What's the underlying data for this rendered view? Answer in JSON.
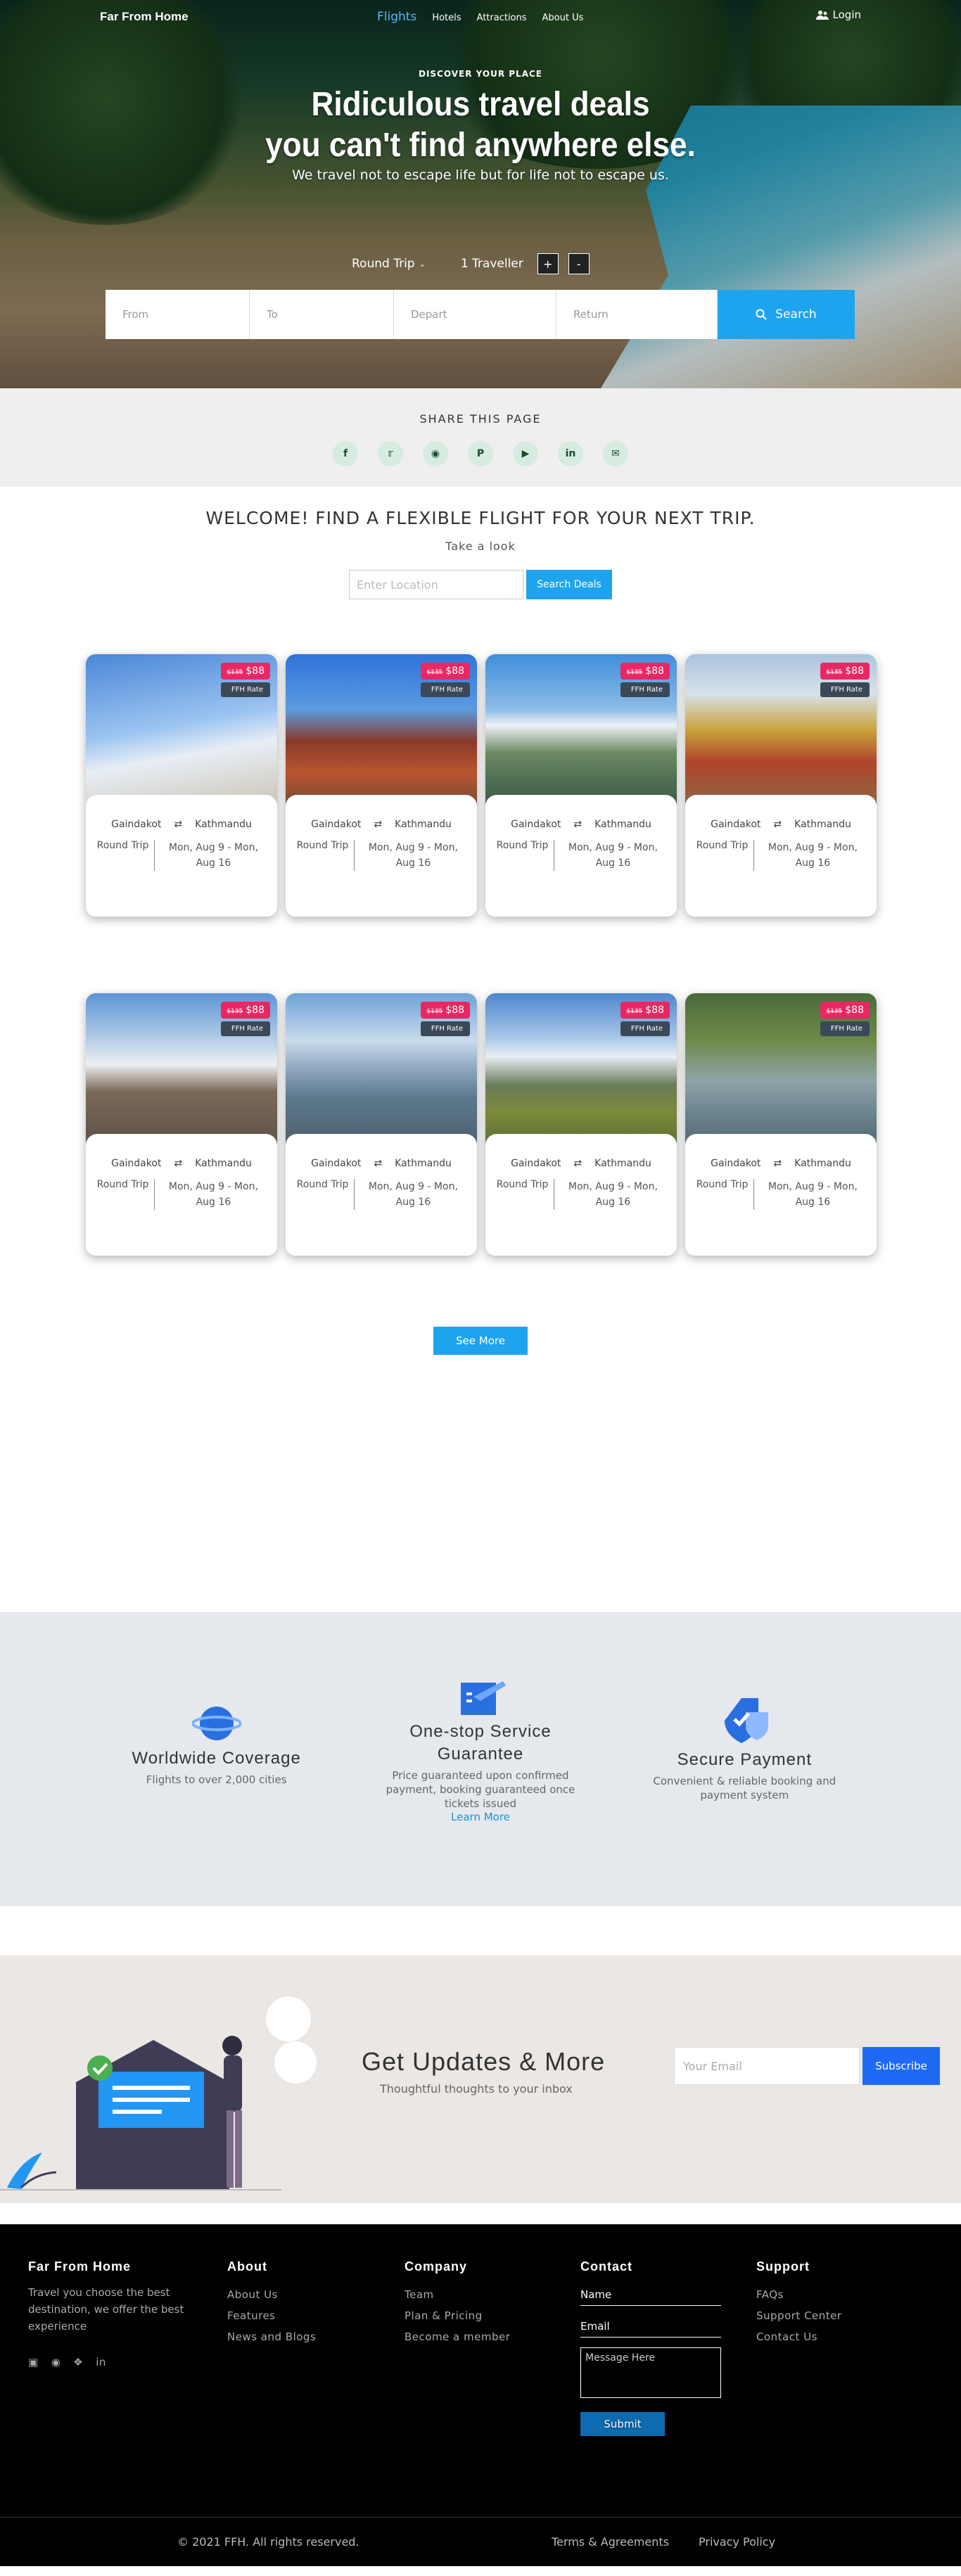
{
  "nav": {
    "brand": "Far From Home",
    "links": [
      "Flights",
      "Hotels",
      "Attractions",
      "About Us"
    ],
    "login": "Login"
  },
  "hero": {
    "eyebrow": "DISCOVER YOUR PLACE",
    "title1": "Ridiculous travel deals",
    "title2": "you can't find anywhere else.",
    "subtitle": "We travel not to escape life but for life not to escape us.",
    "trip_type": "Round Trip",
    "traveller": "1 Traveller",
    "plus": "+",
    "minus": "-",
    "from": "From",
    "to": "To",
    "depart": "Depart",
    "return": "Return",
    "search": "Search"
  },
  "share": {
    "title": "SHARE THIS PAGE"
  },
  "welcome": {
    "title": "WELCOME! FIND A FLEXIBLE FLIGHT FOR YOUR NEXT TRIP.",
    "sub": "Take a look",
    "placeholder": "Enter Location",
    "button": "Search Deals"
  },
  "card": {
    "old": "$135",
    "price": "$88",
    "rate": "FFH Rate",
    "from": "Gaindakot",
    "to": "Kathmandu",
    "trip": "Round Trip",
    "dates": "Mon, Aug 9 - Mon, Aug 16"
  },
  "see_more": "See More",
  "features": [
    {
      "title": "Worldwide Coverage",
      "text": "Flights to over 2,000 cities"
    },
    {
      "title": "One-stop Service Guarantee",
      "text": "Price guaranteed upon confirmed payment, booking guaranteed once tickets issued",
      "link": "Learn More"
    },
    {
      "title": "Secure Payment",
      "text": "Convenient & reliable booking and payment system"
    }
  ],
  "updates": {
    "title": "Get Updates & More",
    "sub": "Thoughtful thoughts to your inbox",
    "placeholder": "Your Email",
    "button": "Subscribe"
  },
  "footer": {
    "about_title": "Far From Home",
    "about_text": "Travel you choose the best destination, we offer the best experience",
    "c1": "About",
    "c1items": [
      "About Us",
      "Features",
      "News and Blogs"
    ],
    "c2": "Company",
    "c2items": [
      "Team",
      "Plan & Pricing",
      "Become a member"
    ],
    "c3": "Contact",
    "name": "Name",
    "email": "Email",
    "message": "Message Here",
    "submit": "Submit",
    "c4": "Support",
    "c4items": [
      "FAQs",
      "Support Center",
      "Contact Us"
    ],
    "copyright": "© 2021 FFH.  All rights reserved.",
    "terms": "Terms & Agreements",
    "privacy": "Privacy Policy"
  }
}
